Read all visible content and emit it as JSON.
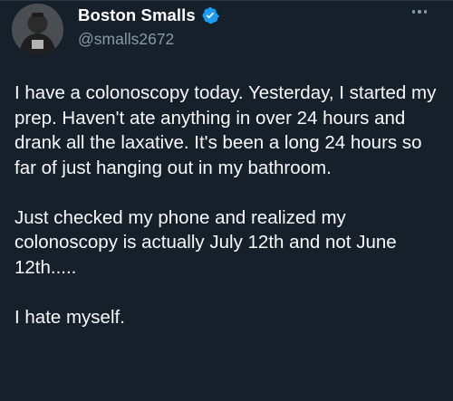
{
  "author": {
    "display_name": "Boston Smalls",
    "handle": "@smalls2672",
    "verified_icon": "verified-badge-icon",
    "avatar_icon": "avatar"
  },
  "actions": {
    "more_icon": "more-options-icon"
  },
  "tweet": {
    "paragraphs": [
      "I have a colonoscopy today. Yesterday, I started my prep. Haven't ate anything in over 24 hours and drank all the laxative. It's been a long 24 hours so far of just hanging out in my bathroom.",
      "Just checked my phone and realized my colonoscopy is actually July 12th and not June 12th.....",
      "I hate myself."
    ]
  },
  "colors": {
    "background": "#15202b",
    "text": "#f7f9f9",
    "secondary_text": "#8b98a5",
    "verified": "#1d9bf0"
  }
}
